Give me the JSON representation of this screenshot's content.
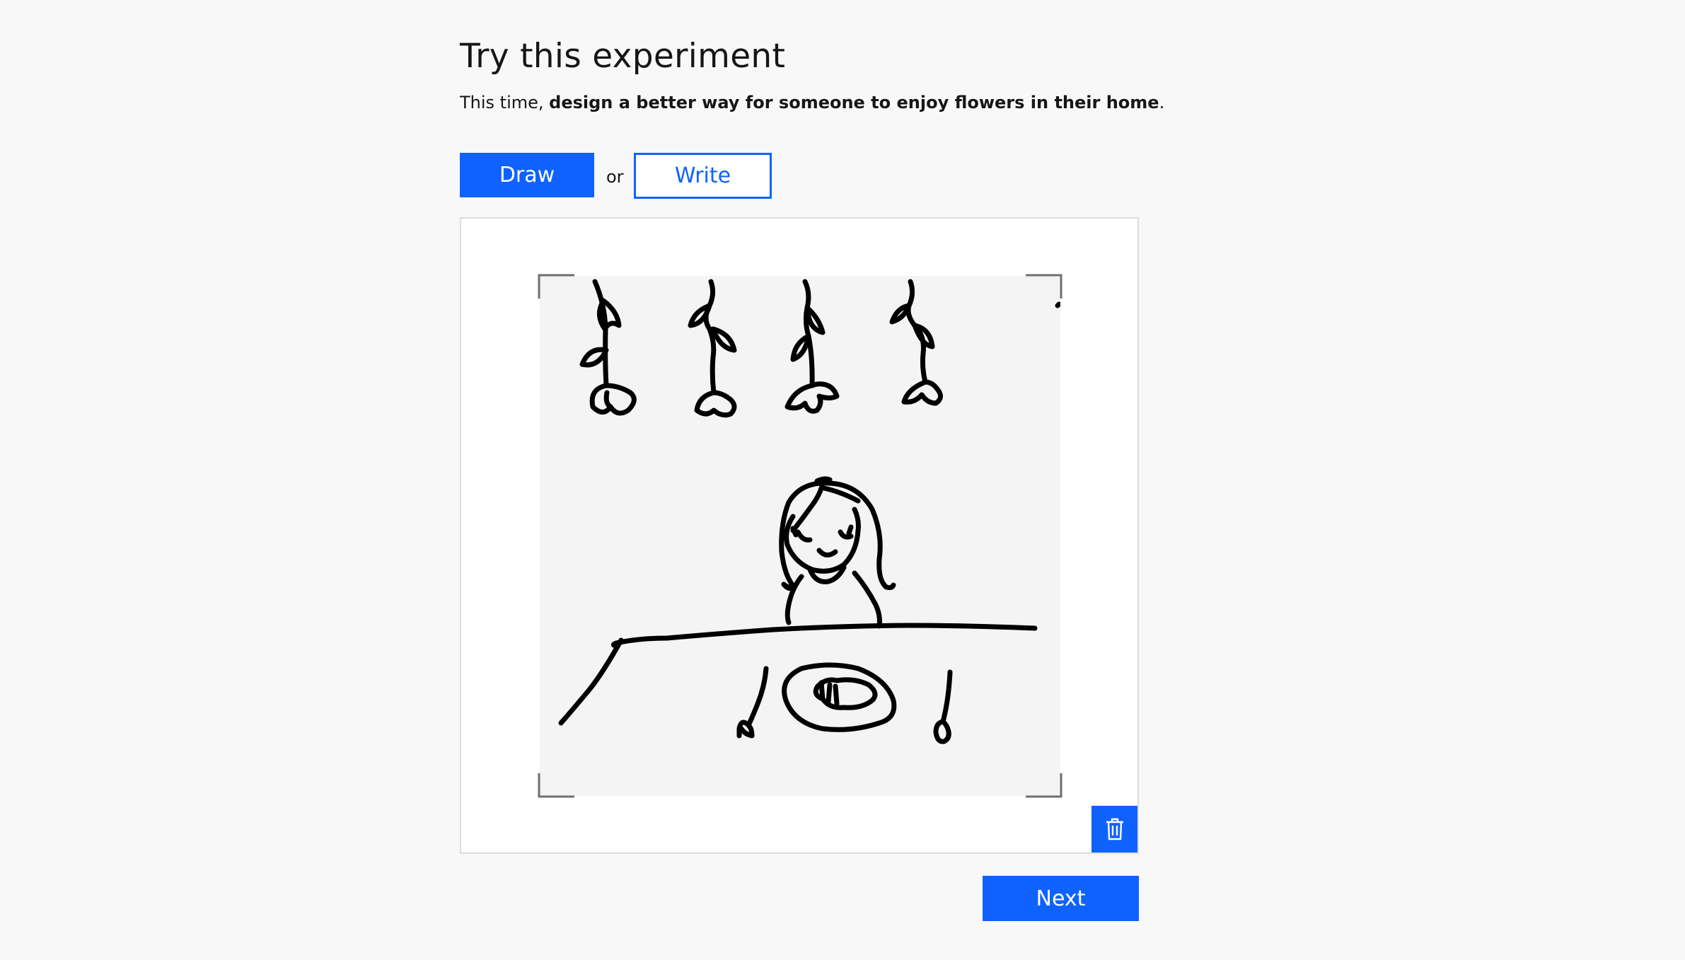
{
  "experiment": {
    "heading": "Try this experiment",
    "instruction_prefix": "This time, ",
    "instruction_bold": "design a better way for someone to enjoy flowers in their home",
    "instruction_suffix": "."
  },
  "mode_toggle": {
    "draw_label": "Draw",
    "or_label": "or",
    "write_label": "Write",
    "selected": "Draw"
  },
  "canvas": {
    "drawing_content": "sketch of a girl at a table with a plate, fork and spoon, with four flowers hanging upside down from above",
    "delete_icon": "trash-icon"
  },
  "footer": {
    "next_label": "Next"
  },
  "colors": {
    "primary": "#0f62fe",
    "background": "#f8f8f8",
    "canvas_bg": "#f4f4f4",
    "text": "#161616"
  }
}
